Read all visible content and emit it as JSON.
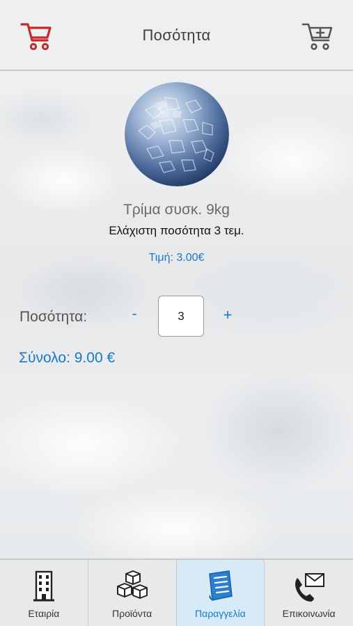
{
  "header": {
    "title": "Ποσότητα",
    "left_icon": "cart-icon",
    "right_icon": "cart-add-icon",
    "left_icon_color": "#c82828",
    "right_icon_color": "#555555"
  },
  "product": {
    "name": "Τρίμα συσκ. 9kg",
    "min_quantity": "Ελάχιστη ποσότητα 3 τεμ.",
    "price": "Τιμή: 3.00€",
    "image_icon": "crushed-ice-image"
  },
  "quantity": {
    "label": "Ποσότητα:",
    "minus": "-",
    "value": "3",
    "plus": "+"
  },
  "total": "Σύνολο: 9.00 €",
  "colors": {
    "accent": "#1a78c8",
    "active_tab_bg": "#d6eaf7"
  },
  "nav": {
    "items": [
      {
        "label": "Εταιρία",
        "icon": "building-icon",
        "active": false
      },
      {
        "label": "Προϊόντα",
        "icon": "ice-cubes-icon",
        "active": false
      },
      {
        "label": "Παραγγελία",
        "icon": "order-list-icon",
        "active": true
      },
      {
        "label": "Επικοινωνία",
        "icon": "phone-mail-icon",
        "active": false
      }
    ]
  }
}
